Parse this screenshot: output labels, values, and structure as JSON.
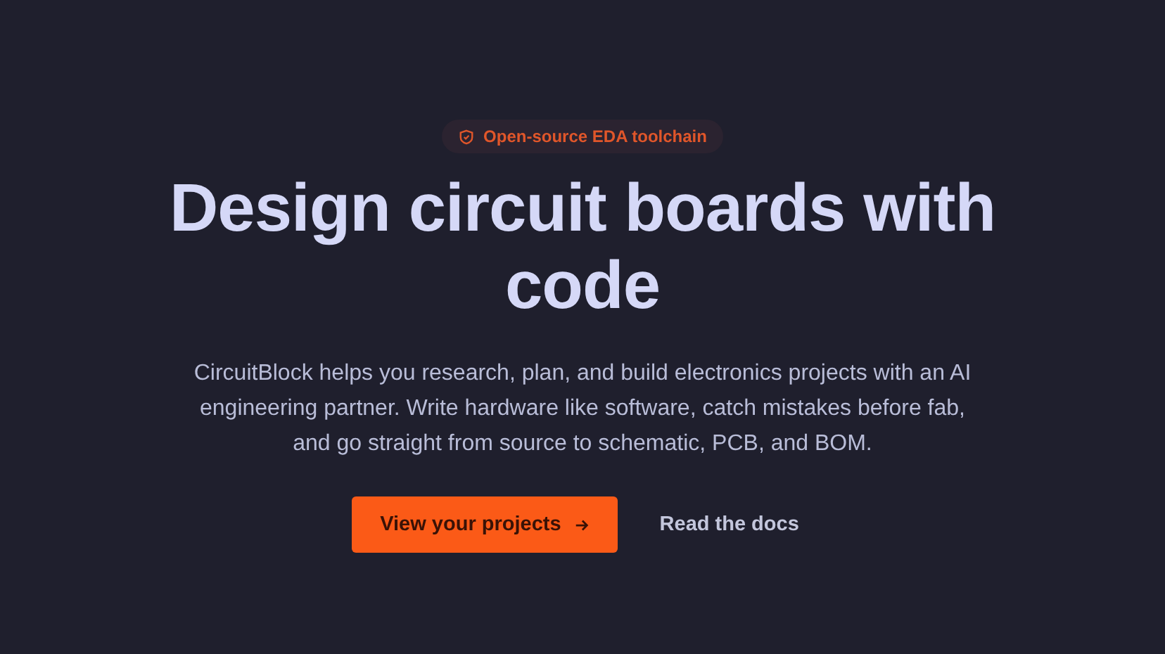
{
  "badge": {
    "label": "Open-source EDA toolchain"
  },
  "heading": "Design circuit boards with code",
  "description": "CircuitBlock helps you research, plan, and build electronics projects with an AI engineering partner. Write hardware like software, catch mistakes before fab, and go straight from source to schematic, PCB, and BOM.",
  "actions": [
    {
      "kind": "primary",
      "label": "View your projects"
    },
    {
      "kind": "link",
      "label": "Read the docs"
    }
  ]
}
